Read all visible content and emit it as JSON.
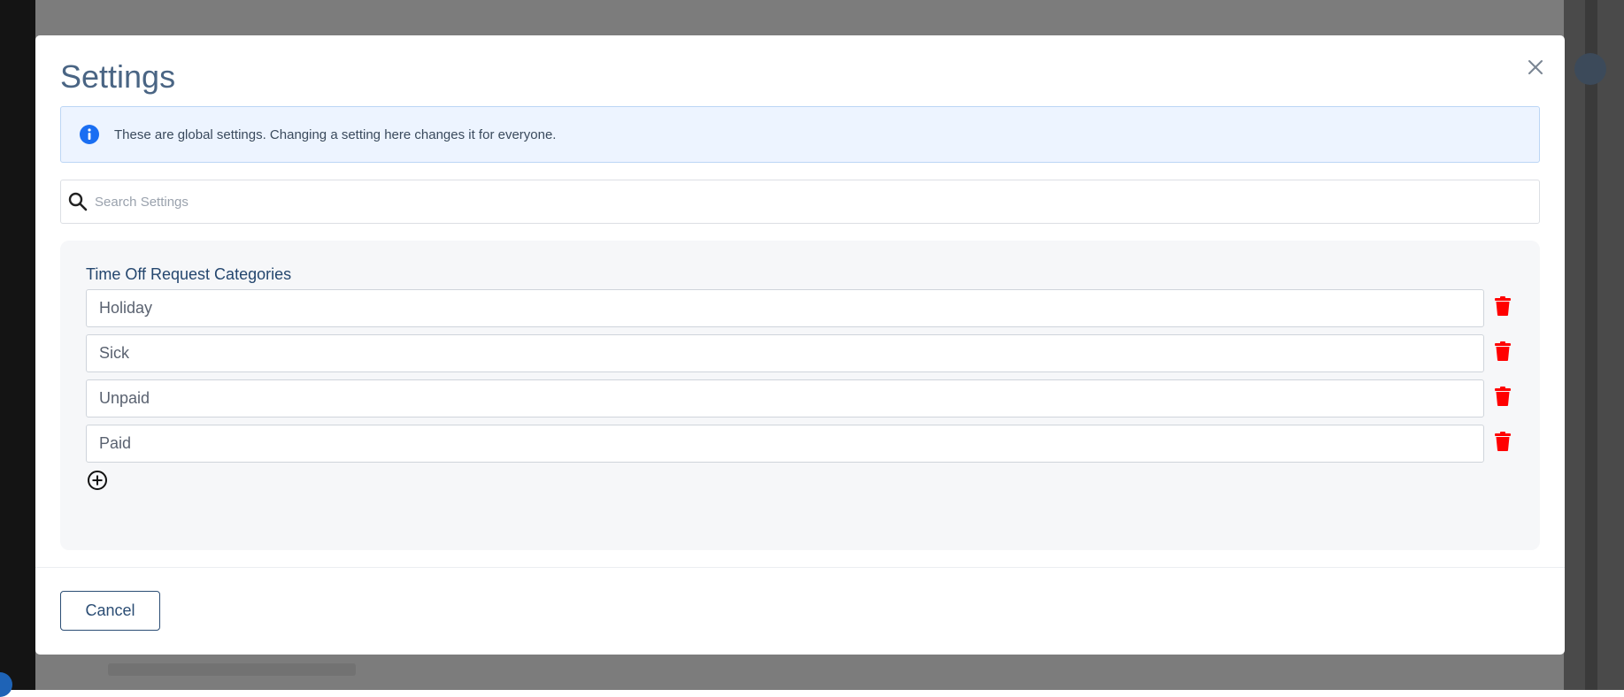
{
  "modal": {
    "title": "Settings",
    "info_text": "These are global settings. Changing a setting here changes it for everyone.",
    "search_placeholder": "Search Settings",
    "section_title": "Time Off Request Categories",
    "categories": [
      "Holiday",
      "Sick",
      "Unpaid",
      "Paid"
    ],
    "cancel_label": "Cancel"
  },
  "icons": {
    "close": "close-icon",
    "info": "info-circle-icon",
    "search": "search-icon",
    "trash": "trash-icon",
    "add": "plus-circle-icon"
  },
  "colors": {
    "title": "#4a6584",
    "info_bg": "#edf4ff",
    "info_icon": "#1a6ef2",
    "section_title": "#24466e",
    "trash": "#ff0000",
    "cancel_border": "#2b4d74",
    "backdrop": "#7c7c7c"
  }
}
